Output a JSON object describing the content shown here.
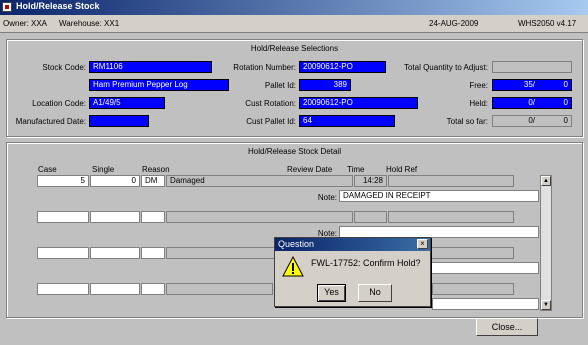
{
  "window": {
    "title": "Hold/Release Stock"
  },
  "info": {
    "owner": "Owner: XXA",
    "warehouse": "Warehouse: XX1",
    "date": "24-AUG-2009",
    "version": "WHS2050  v4.17"
  },
  "selections": {
    "title": "Hold/Release Selections",
    "stock_code_label": "Stock Code:",
    "stock_code": "RM1106",
    "stock_desc": "Ham Premium Pepper Log",
    "location_label": "Location Code:",
    "location": "A1/49/5",
    "mfg_date_label": "Manufactured Date:",
    "mfg_date": "",
    "rotation_label": "Rotation Number:",
    "rotation": "20090612-PO",
    "pallet_label": "Pallet Id:",
    "pallet": "389",
    "cust_rotation_label": "Cust Rotation:",
    "cust_rotation": "20090612-PO",
    "cust_pallet_label": "Cust Pallet Id:",
    "cust_pallet": "64",
    "total_qty_label": "Total Quantity to Adjust:",
    "total_qty": "",
    "free_label": "Free:",
    "free_a": "35/",
    "free_b": "0",
    "held_label": "Held:",
    "held_a": "0/",
    "held_b": "0",
    "total_label": "Total so far:",
    "total_a": "0/",
    "total_b": "0"
  },
  "detail": {
    "title": "Hold/Release Stock Detail",
    "headers": {
      "case": "Case",
      "single": "Single",
      "reason": "Reason",
      "review": "Review Date",
      "time": "Time",
      "hold_ref": "Hold Ref"
    },
    "row1": {
      "case": "5",
      "single": "0",
      "reason_code": "DM",
      "reason_desc": "Damaged",
      "time": "14:28"
    },
    "note_label": "Note:",
    "note1": "DAMAGED IN RECEIPT"
  },
  "close_button": "Close...",
  "dialog": {
    "title": "Question",
    "message": "FWL-17752:  Confirm Hold?",
    "yes": "Yes",
    "no": "No",
    "close": "×"
  },
  "scroll": {
    "up": "▲",
    "down": "▼"
  },
  "colors": {
    "field_blue": "#0000ff",
    "title_blue": "#0a246a",
    "panel": "#c0c0c0"
  }
}
